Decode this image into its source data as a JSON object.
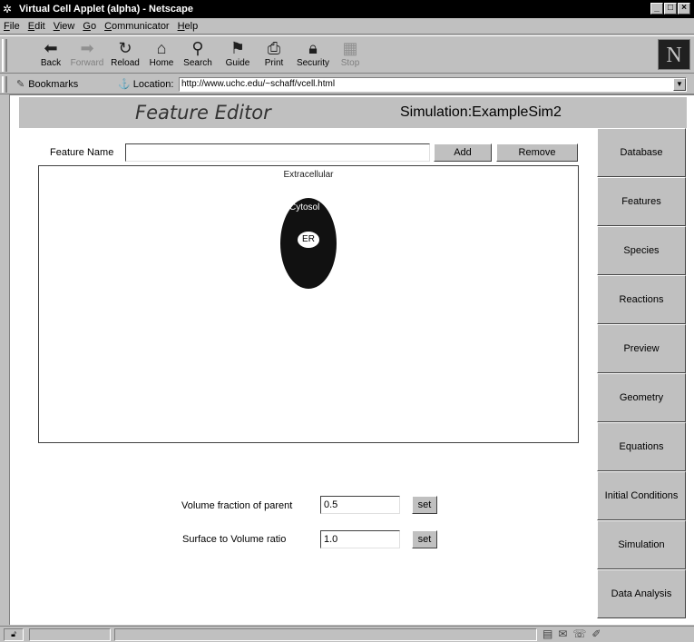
{
  "window": {
    "title": "Virtual Cell Applet (alpha) - Netscape",
    "controls": [
      "_",
      "□",
      "×"
    ]
  },
  "menubar": {
    "items": [
      {
        "key": "F",
        "rest": "ile"
      },
      {
        "key": "E",
        "rest": "dit"
      },
      {
        "key": "V",
        "rest": "iew"
      },
      {
        "key": "G",
        "rest": "o"
      },
      {
        "key": "C",
        "rest": "ommunicator"
      },
      {
        "key": "H",
        "rest": "elp"
      }
    ]
  },
  "toolbar": {
    "back": "Back",
    "forward": "Forward",
    "reload": "Reload",
    "home": "Home",
    "search": "Search",
    "guide": "Guide",
    "print": "Print",
    "security": "Security",
    "stop": "Stop",
    "logo": "N"
  },
  "locationbar": {
    "bookmarks": "Bookmarks",
    "location_label": "Location:",
    "url": "http://www.uchc.edu/~schaff/vcell.html"
  },
  "applet": {
    "header_title": "Feature Editor",
    "simulation_label": "Simulation:ExampleSim2",
    "feature_name_label": "Feature Name",
    "feature_name_value": "",
    "add_label": "Add",
    "remove_label": "Remove",
    "canvas": {
      "outer_label": "Extracellular",
      "cytosol_label": "Cytosol",
      "er_label": "ER"
    },
    "params": {
      "volume_fraction_label": "Volume fraction of parent",
      "volume_fraction_value": "0.5",
      "surface_volume_label": "Surface to Volume ratio",
      "surface_volume_value": "1.0",
      "set_label": "set"
    },
    "nav": [
      "Database",
      "Features",
      "Species",
      "Reactions",
      "Preview",
      "Geometry",
      "Equations",
      "Initial Conditions",
      "Simulation",
      "Data Analysis"
    ]
  }
}
